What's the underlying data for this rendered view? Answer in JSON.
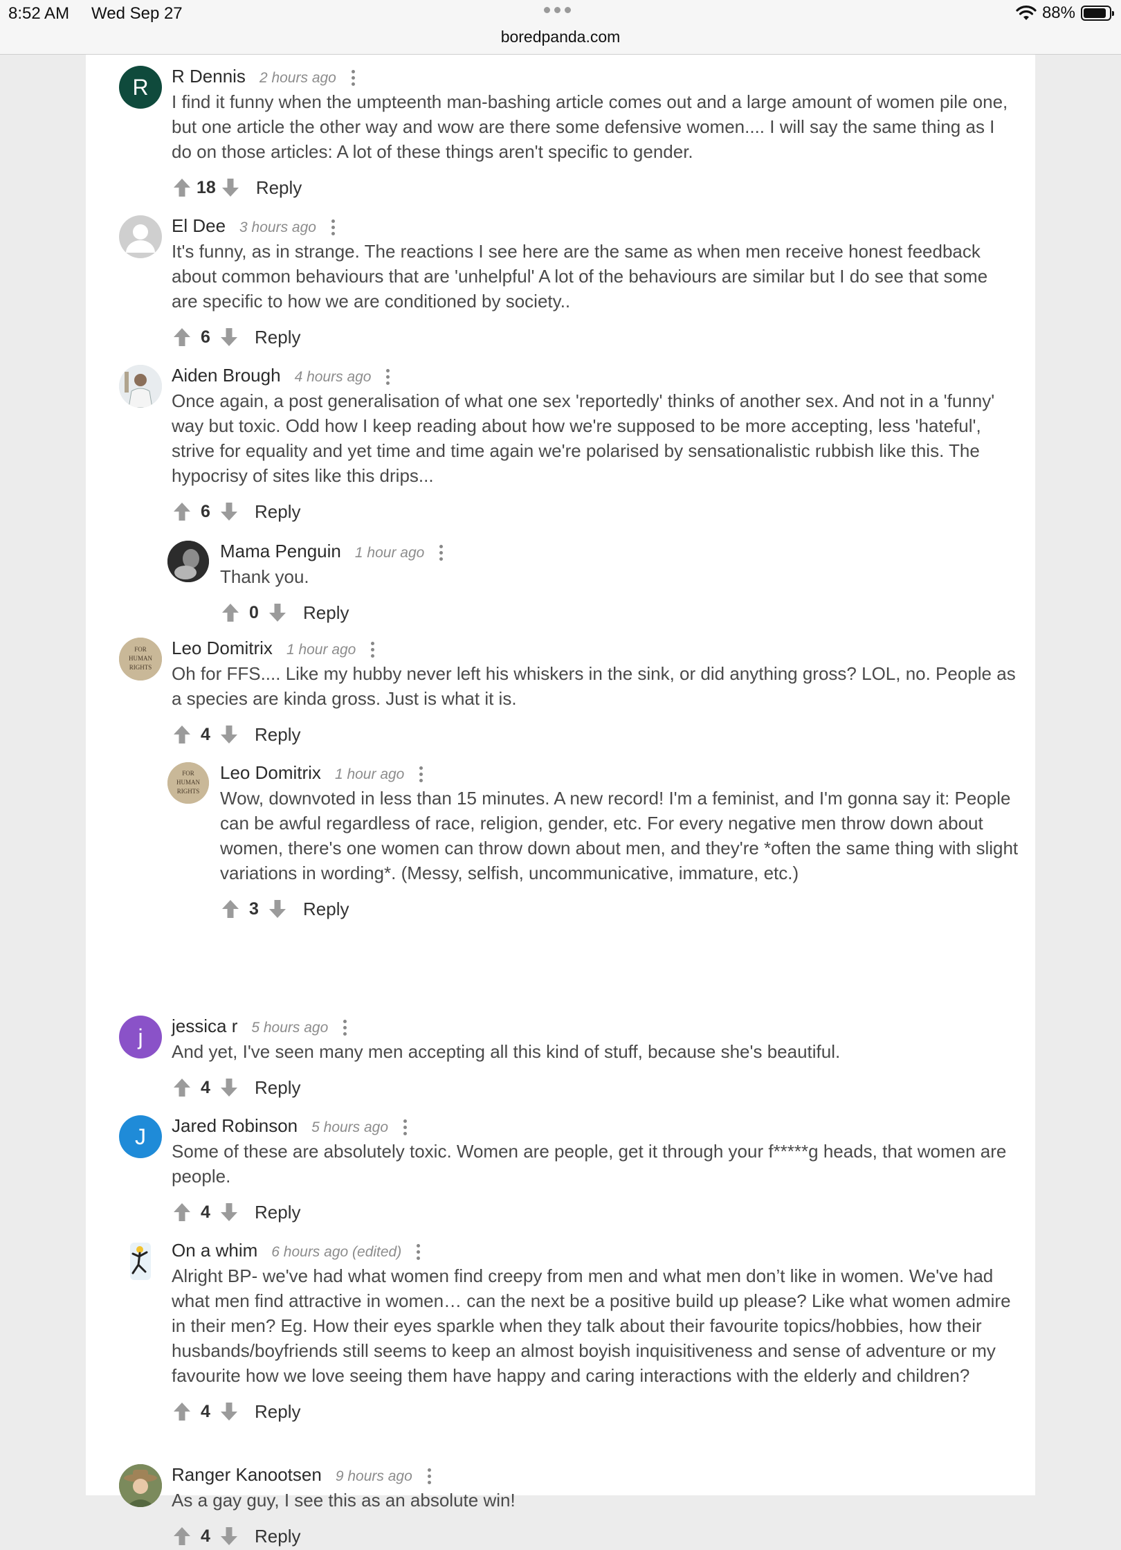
{
  "status": {
    "time": "8:52 AM",
    "date": "Wed Sep 27",
    "battery": "88%",
    "battery_level": 0.88
  },
  "browser": {
    "url": "boredpanda.com"
  },
  "colors": {
    "reply_avatar_R": "#0f4a3c",
    "avatar_j": "#8a52c8",
    "avatar_J": "#1f8bd8",
    "avatar_default": "#cfcfcf"
  },
  "reply_label": "Reply",
  "comments": [
    {
      "author": "R Dennis",
      "time": "2 hours ago",
      "avatar_letter": "R",
      "text": "I find it funny when the umpteenth man-bashing article comes out and a large amount of women pile one, but one article the other way and wow are there some defensive women.... I will say the same thing as I do on those articles: A lot of these things aren't specific to gender.",
      "votes": "18"
    },
    {
      "author": "El Dee",
      "time": "3 hours ago",
      "avatar_letter": "",
      "text": "It's funny, as in strange. The reactions I see here are the same as when men receive honest feedback about common behaviours that are 'unhelpful' A lot of the behaviours are similar but I do see that some are specific to how we are conditioned by society..",
      "votes": "6"
    },
    {
      "author": "Aiden Brough",
      "time": "4 hours ago",
      "avatar_letter": "",
      "text": "Once again, a post generalisation of what one sex 'reportedly' thinks of another sex. And not in a 'funny' way but toxic. Odd how I keep reading about how we're supposed to be more accepting, less 'hateful', strive for equality and yet time and time again we're polarised by sensationalistic rubbish like this. The hypocrisy of sites like this drips...",
      "votes": "6"
    },
    {
      "author": "Mama Penguin",
      "time": "1 hour ago",
      "avatar_letter": "",
      "text": "Thank you.",
      "votes": "0"
    },
    {
      "author": "Leo Domitrix",
      "time": "1 hour ago",
      "avatar_letter": "",
      "avatar_badge": [
        "FOR",
        "HUMAN",
        "RIGHTS"
      ],
      "text": "Oh for FFS.... Like my hubby never left his whiskers in the sink, or did anything gross? LOL, no. People as a species are kinda gross. Just is what it is.",
      "votes": "4"
    },
    {
      "author": "Leo Domitrix",
      "time": "1 hour ago",
      "avatar_letter": "",
      "avatar_badge": [
        "FOR",
        "HUMAN",
        "RIGHTS"
      ],
      "text": "Wow, downvoted in less than 15 minutes. A new record! I'm a feminist, and I'm gonna say it: People can be awful regardless of race, religion, gender, etc. For every negative men throw down about women, there's one women can throw down about men, and they're *often the same thing with slight variations in wording*. (Messy, selfish, uncommunicative, immature, etc.)",
      "votes": "3"
    },
    {
      "author": "jessica r",
      "time": "5 hours ago",
      "avatar_letter": "j",
      "text": "And yet, I've seen many men accepting all this kind of stuff, because she's beautiful.",
      "votes": "4"
    },
    {
      "author": "Jared Robinson",
      "time": "5 hours ago",
      "avatar_letter": "J",
      "text": "Some of these are absolutely toxic. Women are people, get it through your f*****g heads, that women are people.",
      "votes": "4"
    },
    {
      "author": "On a whim",
      "time": "6 hours ago (edited)",
      "avatar_letter": "",
      "text": "Alright BP- we've had what women find creepy from men and what men don’t like in women. We've had what men find attractive in women… can the next be a positive build up please? Like what women admire in their men? Eg. How their eyes sparkle when they talk about their favourite topics/hobbies, how their husbands/boyfriends still seems to keep an almost boyish inquisitiveness and sense of adventure or my favourite how we love seeing them have happy and caring interactions with the elderly and children?",
      "votes": "4"
    },
    {
      "author": "Ranger Kanootsen",
      "time": "9 hours ago",
      "avatar_letter": "",
      "text": "As a gay guy, I see this as an absolute win!",
      "votes": "4"
    }
  ]
}
